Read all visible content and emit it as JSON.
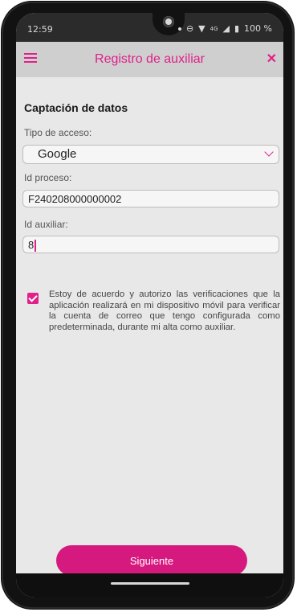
{
  "status_bar": {
    "time": "12:59",
    "network": "4G",
    "battery": "100 %"
  },
  "app_bar": {
    "title": "Registro de auxiliar",
    "menu_icon": "hamburger-icon",
    "close_icon": "close-icon"
  },
  "form": {
    "section_title": "Captación de datos",
    "access_type": {
      "label": "Tipo de acceso:",
      "value": "Google"
    },
    "process_id": {
      "label": "Id proceso:",
      "value": "F240208000000002"
    },
    "aux_id": {
      "label": "Id auxiliar:",
      "value": "8"
    }
  },
  "consent": {
    "checked": true,
    "text": "Estoy de acuerdo y autorizo las verificaciones que la aplicación realizará en mi dispositivo móvil para verificar la cuenta de correo que tengo configurada como predeterminada, durante mi alta como auxiliar."
  },
  "actions": {
    "next_label": "Siguiente"
  },
  "colors": {
    "accent": "#e0218a",
    "button": "#d6197f",
    "background": "#e8e8e8",
    "app_bar": "#cfcfcf"
  }
}
